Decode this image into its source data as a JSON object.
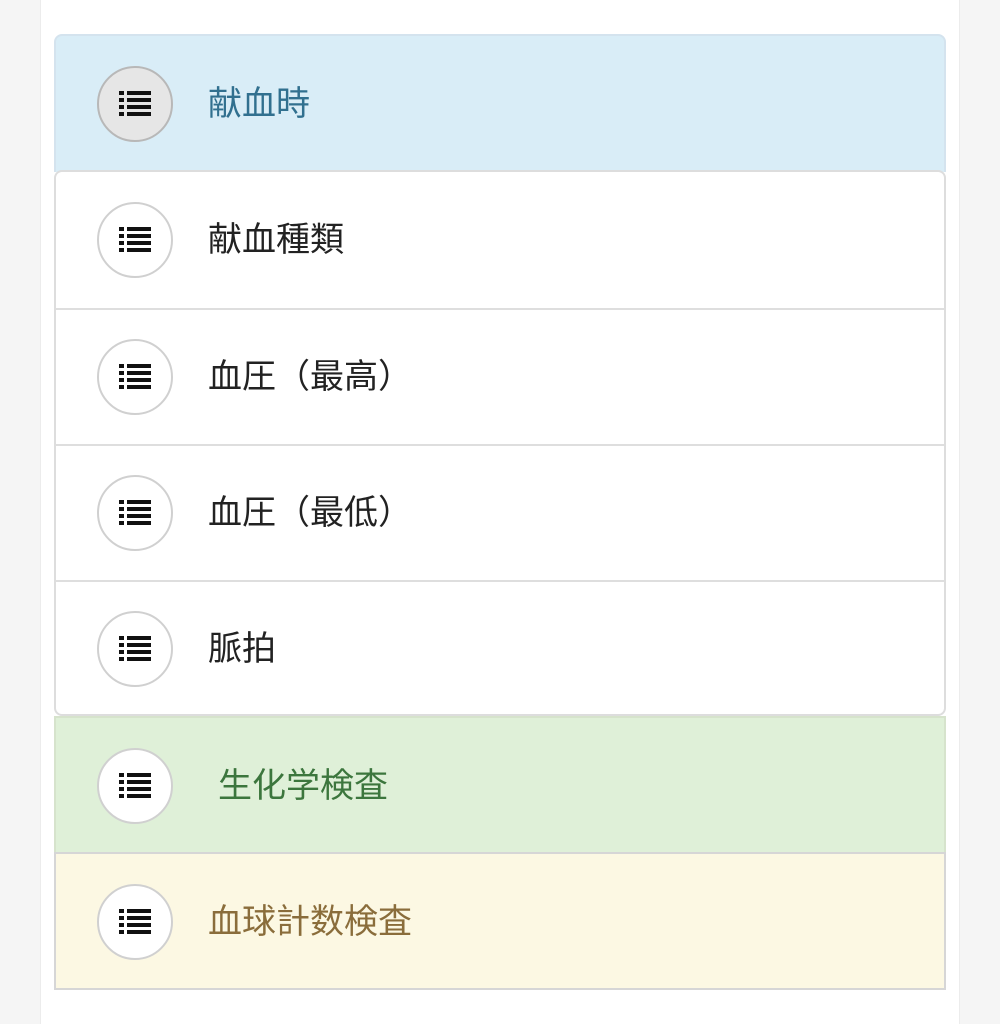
{
  "sections": {
    "blood_donation": {
      "label": "献血時",
      "icon": "list-icon",
      "style": "info",
      "color": "#d9edf7"
    },
    "blood_donation_items": [
      {
        "label": "献血種類",
        "icon": "list-icon"
      },
      {
        "label": "血圧（最高）",
        "icon": "list-icon"
      },
      {
        "label": "血圧（最低）",
        "icon": "list-icon"
      },
      {
        "label": "脈拍",
        "icon": "list-icon"
      }
    ],
    "biochemistry": {
      "label": "生化学検査",
      "icon": "list-icon",
      "style": "success",
      "color": "#dff0d8"
    },
    "blood_count": {
      "label": "血球計数検査",
      "icon": "list-icon",
      "style": "warning",
      "color": "#fcf8e3"
    }
  }
}
